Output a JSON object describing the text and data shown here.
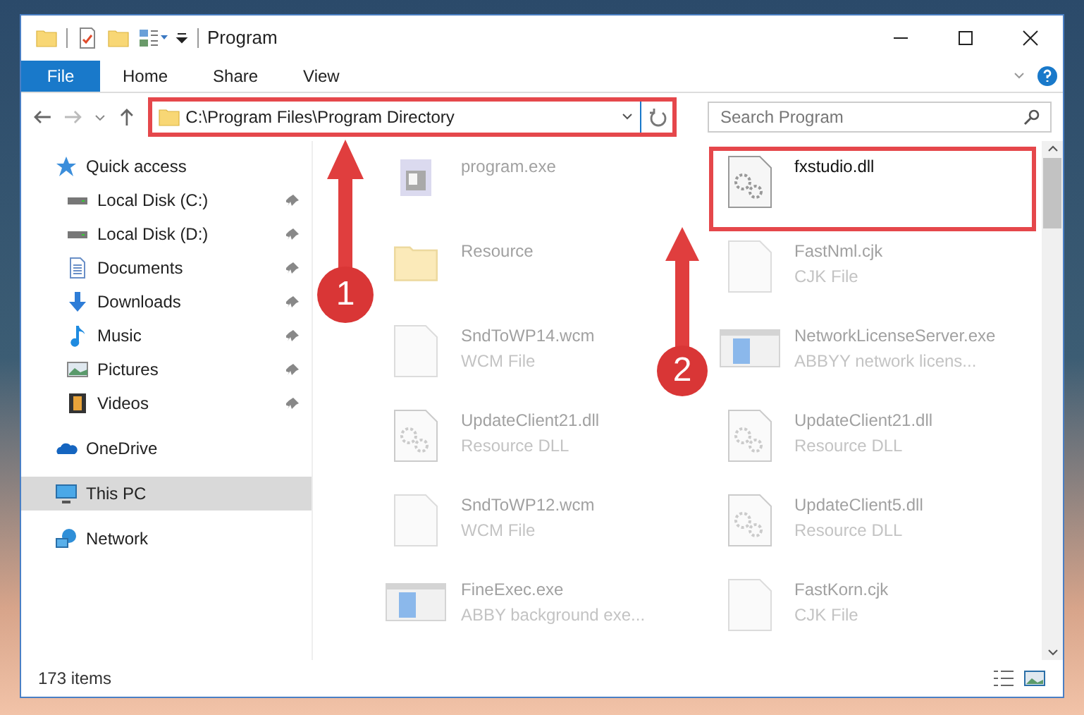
{
  "window": {
    "title": "Program"
  },
  "ribbon": {
    "tabs": [
      {
        "label": "File",
        "selected": true
      },
      {
        "label": "Home",
        "selected": false
      },
      {
        "label": "Share",
        "selected": false
      },
      {
        "label": "View",
        "selected": false
      }
    ]
  },
  "address_bar": {
    "path": "C:\\Program Files\\Program Directory",
    "highlighted": true
  },
  "search": {
    "placeholder": "Search Program"
  },
  "sidebar": {
    "items": [
      {
        "label": "Quick access",
        "kind": "star",
        "selected": false,
        "children": [
          {
            "label": "Local Disk (C:)",
            "kind": "drive",
            "selected": false,
            "pinned": true
          },
          {
            "label": "Local Disk (D:)",
            "kind": "drive",
            "selected": false,
            "pinned": true
          },
          {
            "label": "Documents",
            "kind": "documents",
            "selected": false,
            "pinned": true
          },
          {
            "label": "Downloads",
            "kind": "downloads",
            "selected": false,
            "pinned": true
          },
          {
            "label": "Music",
            "kind": "music",
            "selected": false,
            "pinned": true
          },
          {
            "label": "Pictures",
            "kind": "pictures",
            "selected": false,
            "pinned": true
          },
          {
            "label": "Videos",
            "kind": "videos",
            "selected": false,
            "pinned": true
          }
        ]
      },
      {
        "label": "OneDrive",
        "kind": "cloud",
        "selected": false
      },
      {
        "label": "This PC",
        "kind": "pc",
        "selected": true
      },
      {
        "label": "Network",
        "kind": "network",
        "selected": false
      }
    ]
  },
  "files": [
    {
      "name": "program.exe",
      "kind": "app",
      "faded": true,
      "highlighted": false
    },
    {
      "name": "fxstudio.dll",
      "kind": "dll",
      "faded": false,
      "highlighted": true
    },
    {
      "name": "Resource",
      "kind": "folder",
      "faded": true,
      "highlighted": false
    },
    {
      "name": "FastNml.cjk",
      "type": "CJK File",
      "kind": "doc",
      "faded": true,
      "highlighted": false
    },
    {
      "name": "SndToWP14.wcm",
      "type": "WCM File",
      "kind": "doc",
      "faded": true,
      "highlighted": false
    },
    {
      "name": "NetworkLicenseServer.exe",
      "type": "ABBYY network licens...",
      "kind": "window",
      "faded": true,
      "highlighted": false
    },
    {
      "name": "UpdateClient21.dll",
      "type": "Resource DLL",
      "kind": "dll",
      "faded": true,
      "highlighted": false
    },
    {
      "name": "UpdateClient21.dll",
      "type": "Resource DLL",
      "kind": "dll",
      "faded": true,
      "highlighted": false
    },
    {
      "name": "SndToWP12.wcm",
      "type": "WCM File",
      "kind": "doc",
      "faded": true,
      "highlighted": false
    },
    {
      "name": "UpdateClient5.dll",
      "type": "Resource DLL",
      "kind": "dll",
      "faded": true,
      "highlighted": false
    },
    {
      "name": "FineExec.exe",
      "type": "ABBY background exe...",
      "kind": "window",
      "faded": true,
      "highlighted": false
    },
    {
      "name": "FastKorn.cjk",
      "type": "CJK File",
      "kind": "doc",
      "faded": true,
      "highlighted": false
    }
  ],
  "annotations": [
    {
      "label": "1"
    },
    {
      "label": "2"
    }
  ],
  "status_bar": {
    "count": "173 items"
  }
}
